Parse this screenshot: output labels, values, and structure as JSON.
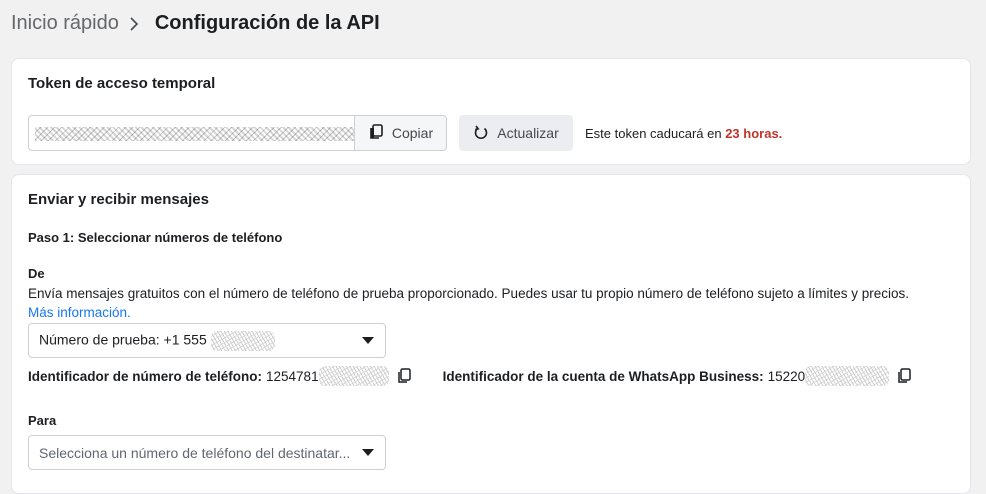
{
  "breadcrumb": {
    "parent": "Inicio rápido",
    "current": "Configuración de la API"
  },
  "token_card": {
    "title": "Token de acceso temporal",
    "copy_label": "Copiar",
    "refresh_label": "Actualizar",
    "expire_prefix": "Este token caducará en ",
    "expire_hours": "23 horas."
  },
  "messages_card": {
    "title": "Enviar y recibir mensajes",
    "step1": "Paso 1: Seleccionar números de teléfono",
    "from_label": "De",
    "from_desc": "Envía mensajes gratuitos con el número de teléfono de prueba proporcionado. Puedes usar tu propio número de teléfono sujeto a límites y precios.",
    "more_info": "Más información.",
    "from_select_value": "Número de prueba: +1 555",
    "phone_id_label": "Identificador de número de teléfono:",
    "phone_id_value": "1254781",
    "waba_id_label": "Identificador de la cuenta de WhatsApp Business:",
    "waba_id_value": "15220",
    "to_label": "Para",
    "to_select_placeholder": "Selecciona un número de teléfono del destinatar..."
  },
  "colors": {
    "accent": "#1877f2",
    "warning": "#c0352b"
  },
  "icons": [
    "chevron-right-icon",
    "copy-icon",
    "refresh-icon",
    "caret-down-icon"
  ]
}
